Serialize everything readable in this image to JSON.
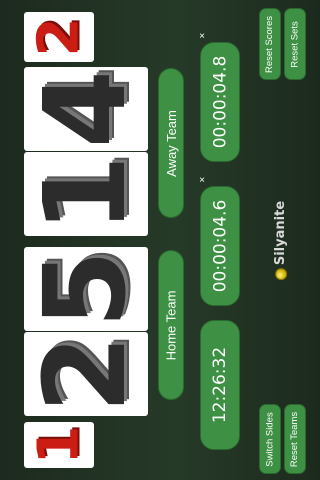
{
  "scoreboard": {
    "home_set": "1",
    "away_set": "2",
    "score_digits": [
      "2",
      "5",
      "1",
      "4"
    ]
  },
  "teams": {
    "home": "Home Team",
    "away": "Away Team"
  },
  "timers": {
    "main_clock": "12:26:32",
    "home_timer": "00:00:04.6",
    "away_timer": "00:00:04.8",
    "close_symbol": "×"
  },
  "buttons": {
    "switch_sides": "Switch Sides",
    "reset_teams": "Reset Teams",
    "reset_scores": "Reset Scores",
    "reset_sets": "Reset Sets"
  },
  "brand": {
    "name": "Silyanite"
  },
  "colors": {
    "accent_green": "#3e9144",
    "set_red": "#cc1d15",
    "background": "#263a28"
  },
  "icons": {
    "close": "close-icon",
    "logo": "brand-logo-icon"
  }
}
